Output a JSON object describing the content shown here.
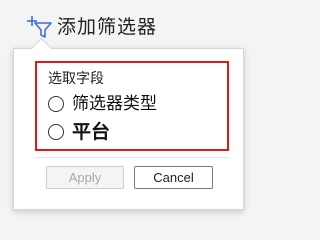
{
  "toolbar": {
    "add_filter_label": "添加筛选器",
    "add_filter_icon": "filter-add-icon",
    "icon_color": "#3b6fd8"
  },
  "popup": {
    "group_title": "选取字段",
    "highlight_color": "#e0191b",
    "options": [
      {
        "label": "筛选器类型",
        "selected": false
      },
      {
        "label": "平台",
        "selected": false
      }
    ],
    "apply_label": "Apply",
    "apply_enabled": false,
    "cancel_label": "Cancel"
  }
}
